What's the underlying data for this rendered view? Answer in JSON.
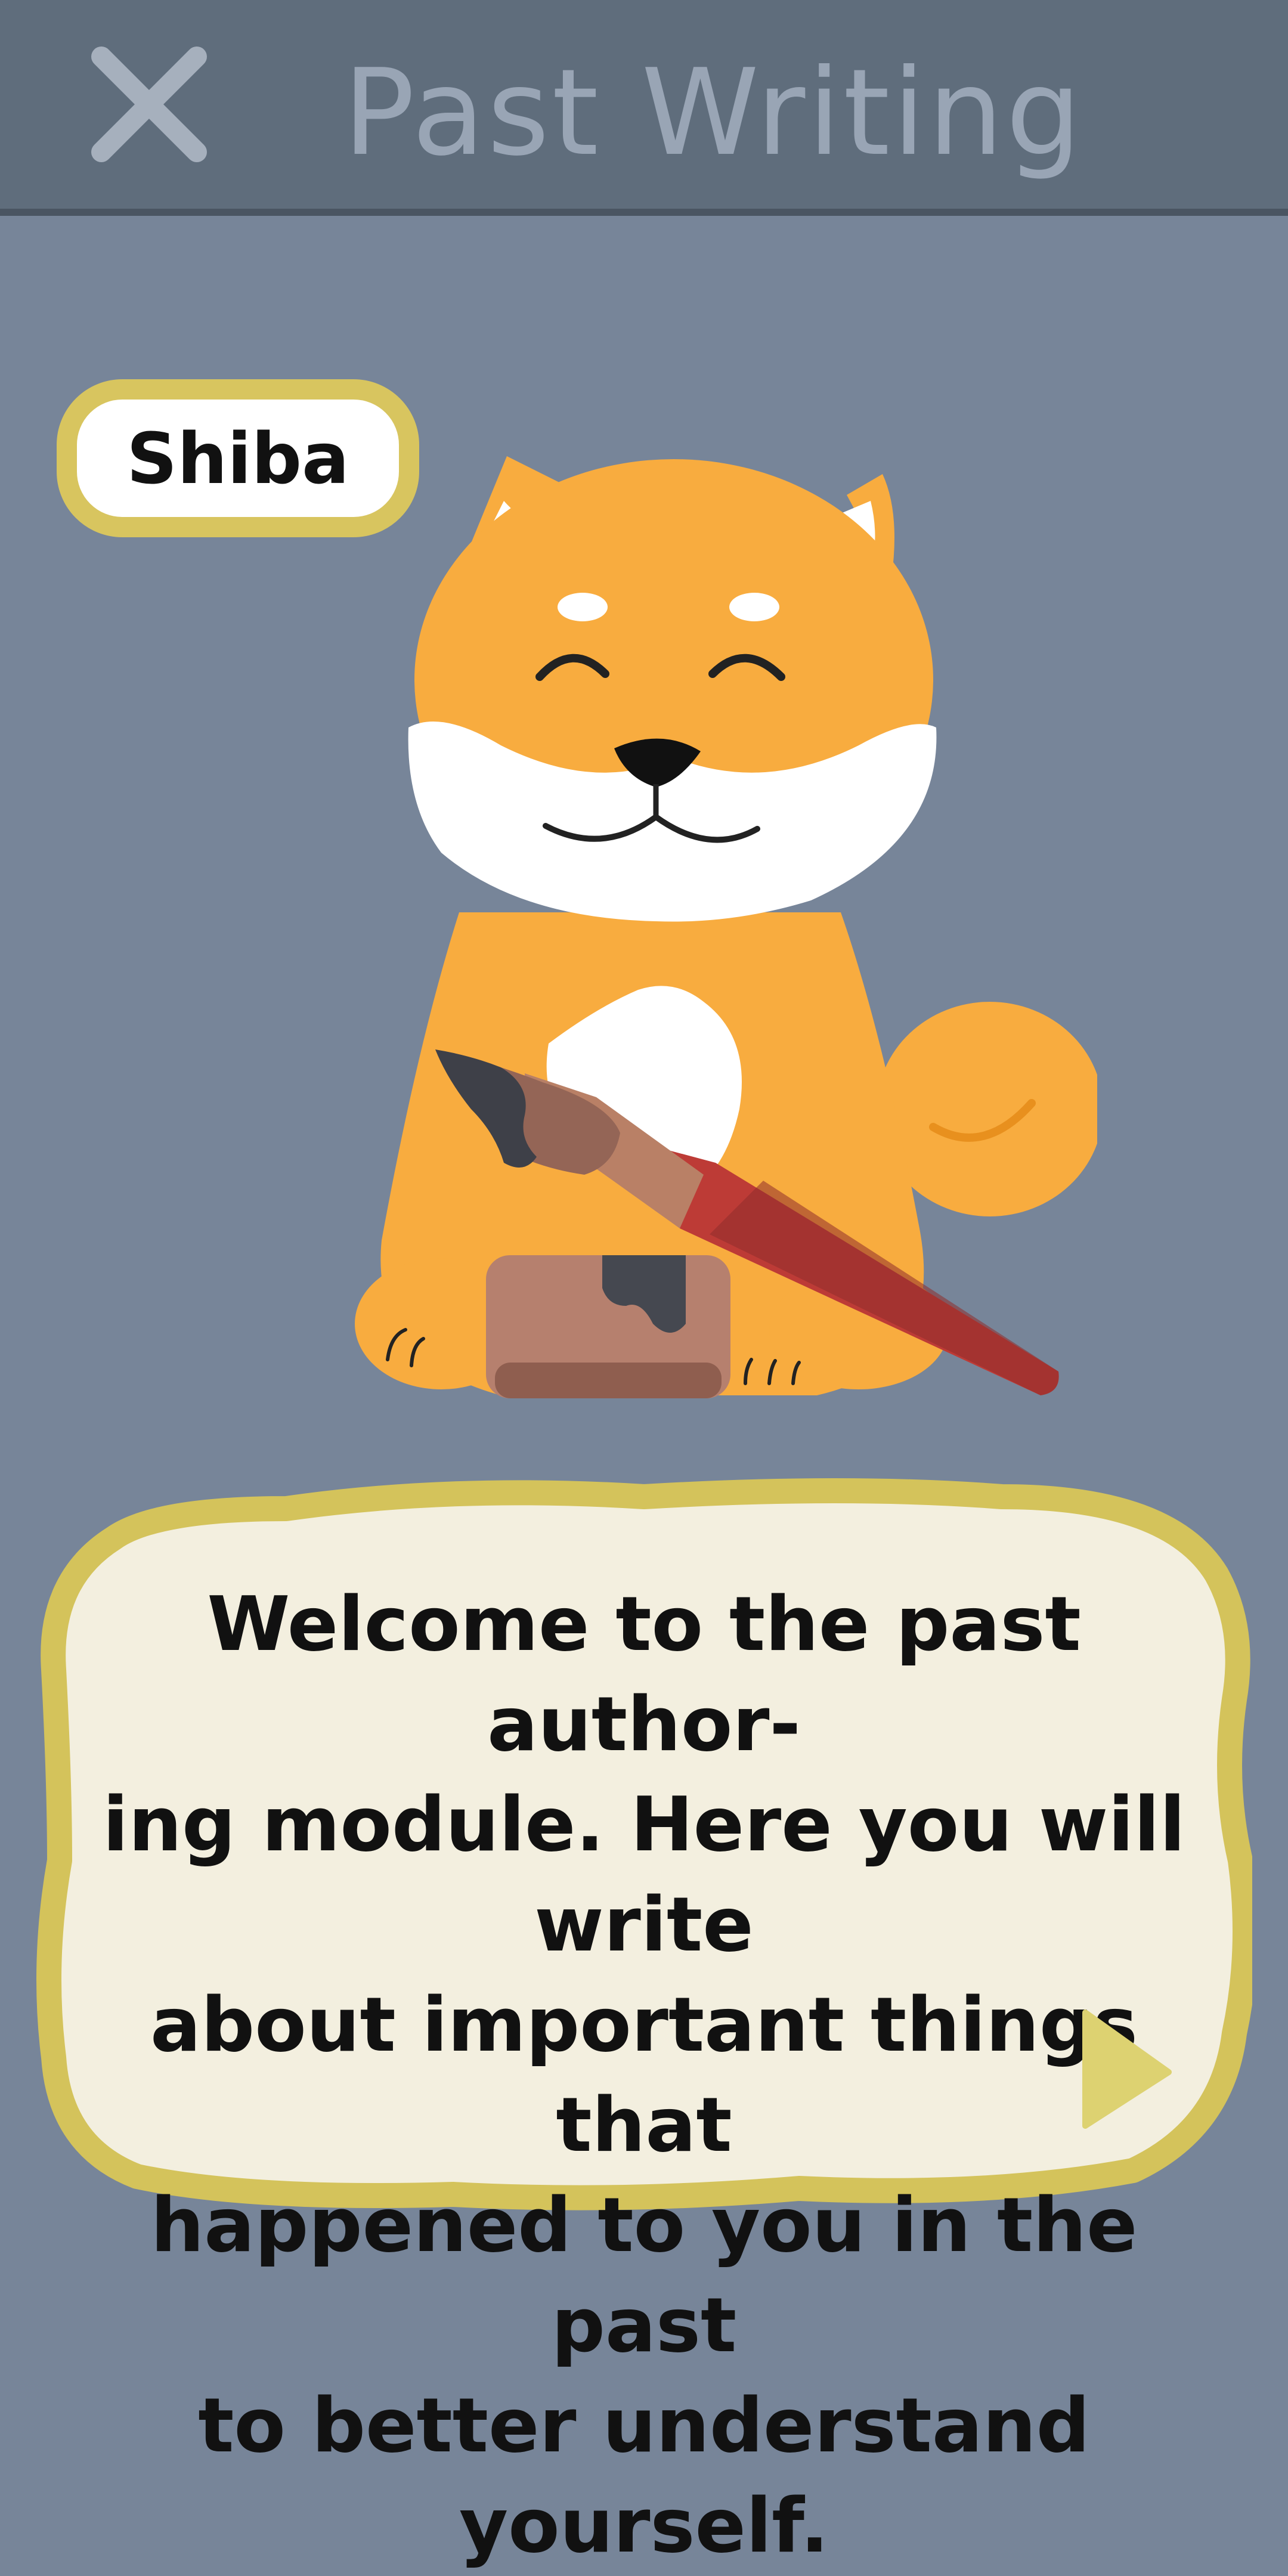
{
  "header": {
    "close_icon": "close-icon",
    "title": "Past Writing"
  },
  "character": {
    "name": "Shiba",
    "illustration": "shiba-dog-with-paintbrush-and-ink-pot"
  },
  "dialog": {
    "text": "Welcome to the past author-\ning module. Here you will write\nabout important things that\nhappened to you in the past\nto better understand\nyourself.",
    "next_icon": "play-triangle-icon"
  },
  "colors": {
    "background": "#778599",
    "header": "#5f6d7c",
    "header_text": "#99a5b5",
    "tag_border": "#d8c55f",
    "bubble_fill": "#f3efdf",
    "bubble_border": "#d4c35b",
    "shiba_orange": "#f8ac3f",
    "brush_red": "#bd3b36"
  }
}
